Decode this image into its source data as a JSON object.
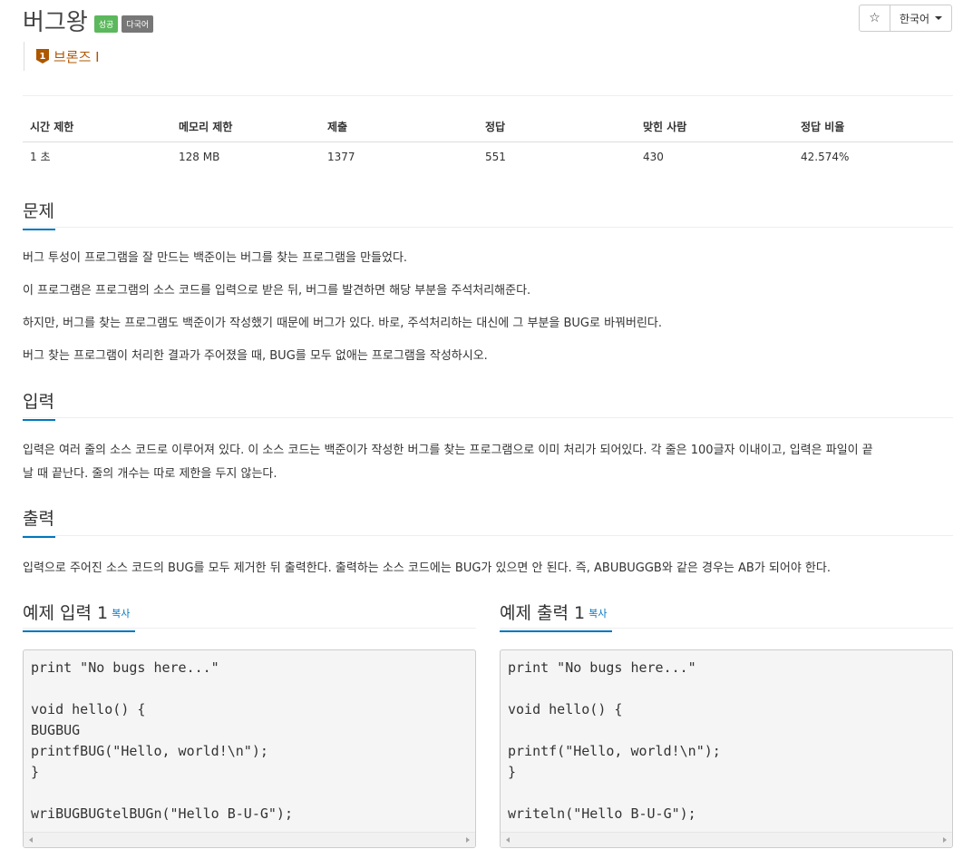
{
  "problem": {
    "title": "버그왕",
    "badges": {
      "success": "성공",
      "multilang": "다국어"
    },
    "tier": {
      "icon_number": "1",
      "label": "브론즈 I"
    }
  },
  "toolbar": {
    "star": "☆",
    "language": "한국어"
  },
  "info_table": {
    "headers": [
      "시간 제한",
      "메모리 제한",
      "제출",
      "정답",
      "맞힌 사람",
      "정답 비율"
    ],
    "values": [
      "1 초",
      "128 MB",
      "1377",
      "551",
      "430",
      "42.574%"
    ]
  },
  "sections": {
    "problem": {
      "heading": "문제",
      "paragraphs": [
        "버그 투성이 프로그램을 잘 만드는 백준이는 버그를 찾는 프로그램을 만들었다.",
        "이 프로그램은 프로그램의 소스 코드를 입력으로 받은 뒤, 버그를 발견하면 해당 부분을 주석처리해준다.",
        "하지만, 버그를 찾는 프로그램도 백준이가 작성했기 때문에 버그가 있다. 바로, 주석처리하는 대신에 그 부분을 BUG로 바꿔버린다.",
        "버그 찾는 프로그램이 처리한 결과가 주어졌을 때, BUG를 모두 없애는 프로그램을 작성하시오."
      ]
    },
    "input": {
      "heading": "입력",
      "line1": "입력은 여러 줄의 소스 코드로 이루어져 있다. 이 소스 코드는 백준이가 작성한 버그를 찾는 프로그램으로 이미 처리가 되어있다. 각 줄은 100글자 이내이고, 입력은 파일이 끝",
      "line2": "날 때 끝난다. 줄의 개수는 따로 제한을 두지 않는다."
    },
    "output": {
      "heading": "출력",
      "text": "입력으로 주어진 소스 코드의 BUG를 모두 제거한 뒤 출력한다. 출력하는 소스 코드에는 BUG가 있으면 안 된다. 즉, ABUBUGGB와 같은 경우는 AB가 되어야 한다."
    }
  },
  "samples": {
    "input": {
      "heading": "예제 입력 1",
      "copy": "복사",
      "code": "print \"No bugs here...\"\n\nvoid hello() {\nBUGBUG\nprintfBUG(\"Hello, world!\\n\");\n}\n\nwriBUGBUGtelBUGn(\"Hello B-U-G\");"
    },
    "output": {
      "heading": "예제 출력 1",
      "copy": "복사",
      "code": "print \"No bugs here...\"\n\nvoid hello() {\n\nprintf(\"Hello, world!\\n\");\n}\n\nwriteln(\"Hello B-U-G\");"
    }
  },
  "colors": {
    "accent": "#0076c0",
    "badge_success": "#5cb85c",
    "badge_gray": "#777777",
    "bronze": "#ad5600"
  }
}
